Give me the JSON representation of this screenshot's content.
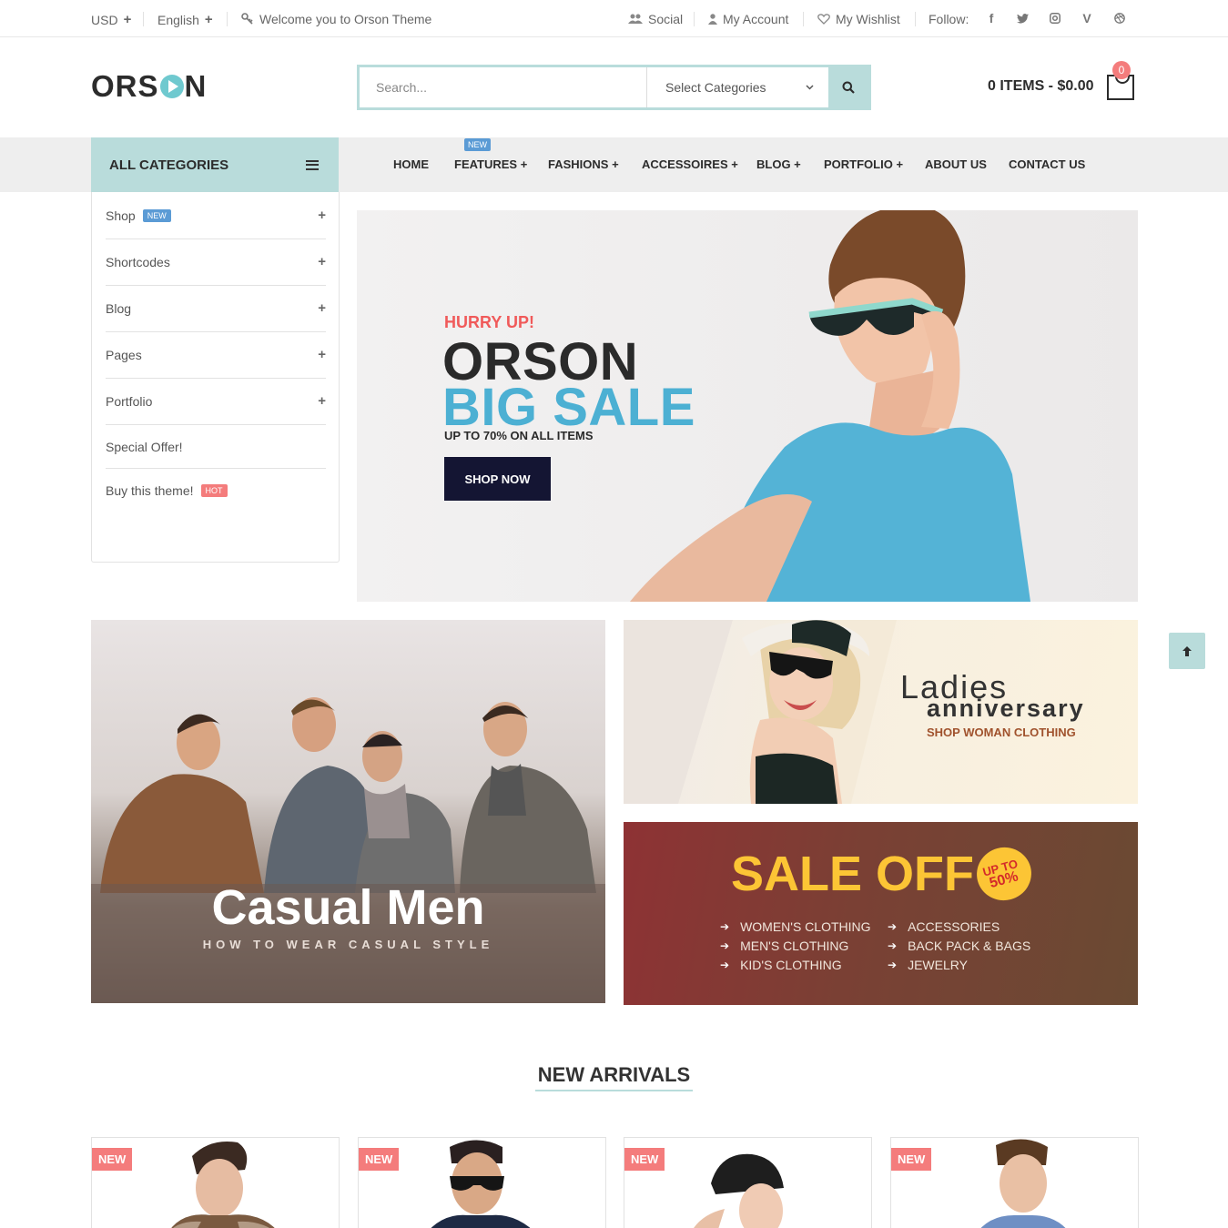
{
  "topbar": {
    "currency": "USD",
    "language": "English",
    "welcome": "Welcome you to Orson Theme",
    "social": "Social",
    "account": "My Account",
    "wishlist": "My Wishlist",
    "follow": "Follow:"
  },
  "header": {
    "logo_left": "ORS",
    "logo_right": "N",
    "search_placeholder": "Search...",
    "category_select": "Select Categories",
    "cart_text": "0 ITEMS - $0.00",
    "cart_count": "0"
  },
  "nav": {
    "all_categories": "ALL CATEGORIES",
    "new_badge": "NEW",
    "links": [
      "HOME",
      "FEATURES +",
      "FASHIONS +",
      "ACCESSOIRES +",
      "BLOG +",
      "PORTFOLIO +",
      "ABOUT US",
      "CONTACT US"
    ]
  },
  "sidebar": {
    "items": [
      {
        "label": "Shop",
        "badge": "NEW"
      },
      {
        "label": "Shortcodes"
      },
      {
        "label": "Blog"
      },
      {
        "label": "Pages"
      },
      {
        "label": "Portfolio"
      },
      {
        "label": "Special Offer!"
      },
      {
        "label": "Buy this theme!",
        "badge": "HOT"
      }
    ]
  },
  "hero": {
    "hurry": "HURRY UP!",
    "line1": "ORSON",
    "line2": "BIG SALE",
    "sub": "UP TO 70% ON ALL ITEMS",
    "button": "SHOP NOW"
  },
  "banners": {
    "men_title": "Casual Men",
    "men_sub": "HOW TO WEAR CASUAL STYLE",
    "ladies_1": "Ladies",
    "ladies_2": "anniversary",
    "ladies_3": "SHOP WOMAN CLOTHING",
    "sale_title": "SALE OFF",
    "sale_badge_1": "UP TO",
    "sale_badge_2": "50%",
    "sale_items": [
      "WOMEN'S CLOTHING",
      "MEN'S CLOTHING",
      "KID'S CLOTHING",
      "ACCESSORIES",
      "BACK PACK & BAGS",
      "JEWELRY"
    ]
  },
  "new_arrivals": {
    "title": "NEW ARRIVALS",
    "badge": "NEW"
  },
  "colors": {
    "accent": "#b9dcdb",
    "hero_blue": "#4cb0d3",
    "hurry_red": "#f05a5a",
    "badge_red": "#f47c7c",
    "sale_yellow": "#fcc535"
  }
}
